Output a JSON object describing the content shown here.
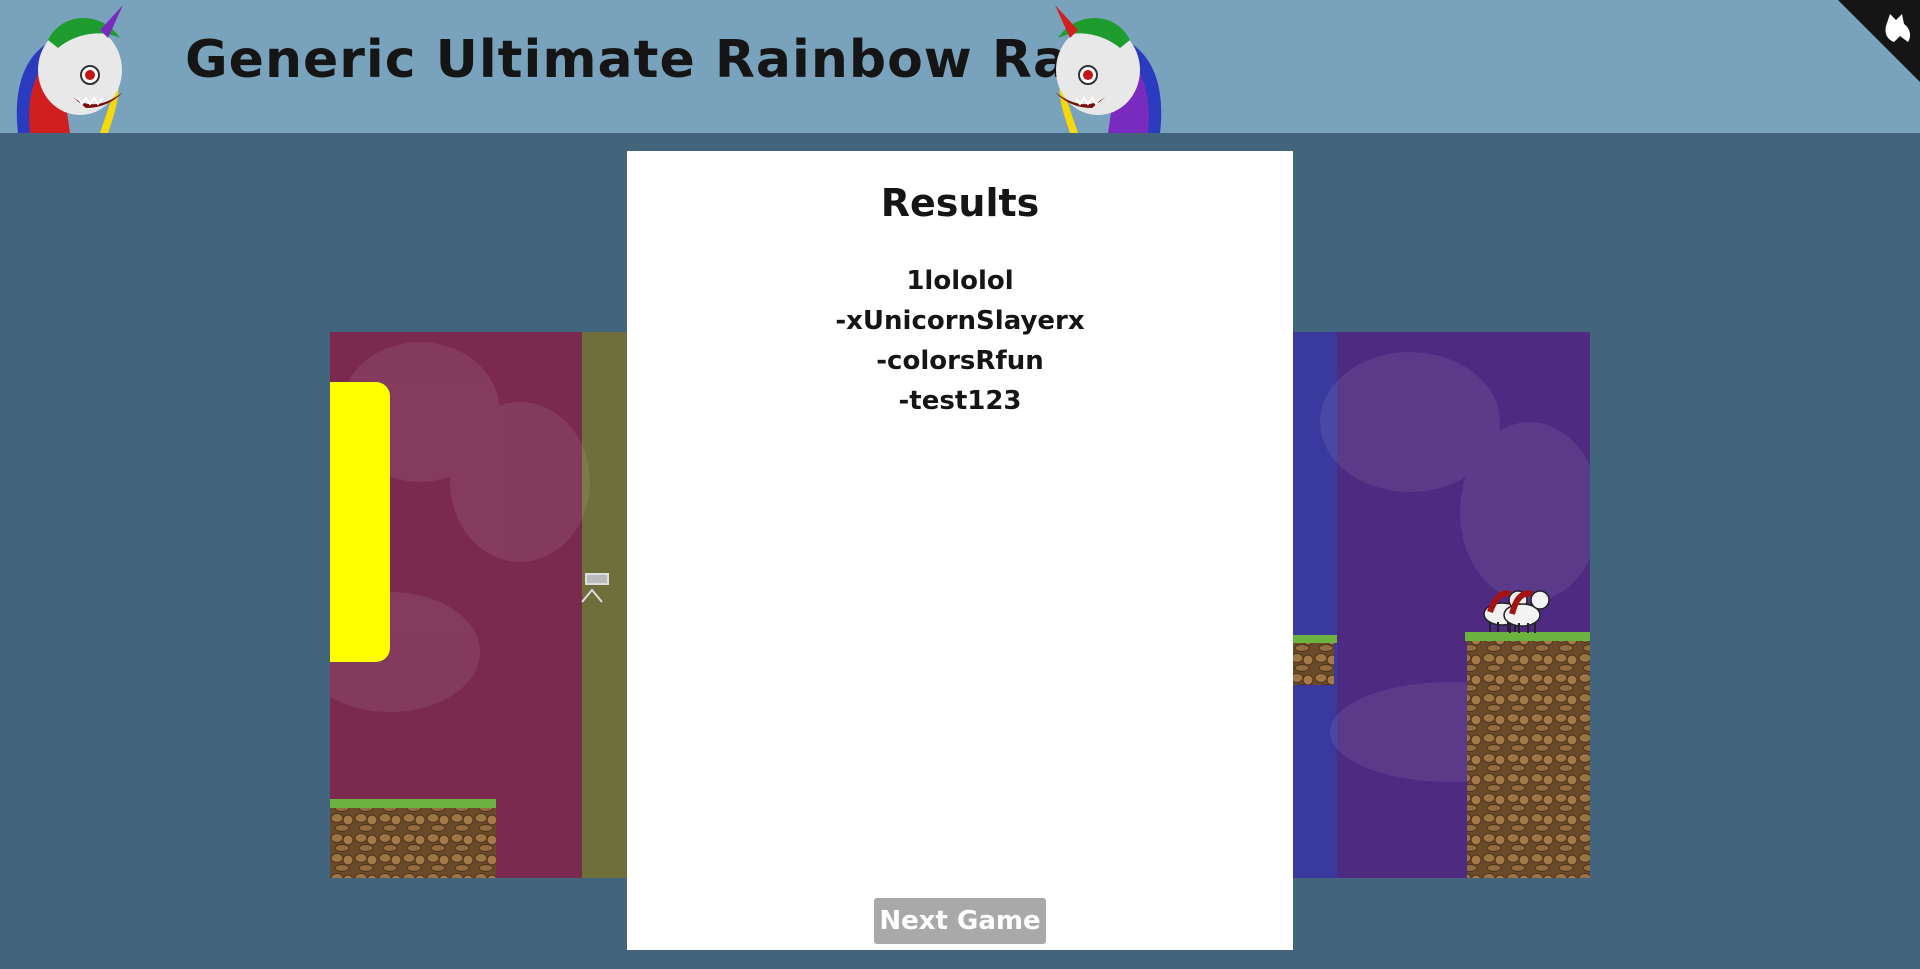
{
  "header": {
    "title": "Generic Ultimate Rainbow Race"
  },
  "results": {
    "heading": "Results",
    "entries": [
      "1lololol",
      "-xUnicornSlayerx",
      "-colorsRfun",
      "-test123"
    ],
    "next_button": "Next Game"
  },
  "game": {
    "lanes": [
      {
        "color": "#7a2a4f"
      },
      {
        "color": "#6f6f3c"
      },
      {
        "color": "#3a3a9e"
      },
      {
        "color": "#4e2a80"
      }
    ],
    "powerup_color": "#ffff00"
  },
  "colors": {
    "page_background": "#42657d",
    "header_background": "#79a3bd",
    "modal_background": "#ffffff",
    "button_background": "#a9a9a9"
  },
  "icons": {
    "mascot": "unicorn-mascot-icon",
    "corner": "cat-silhouette-icon"
  }
}
